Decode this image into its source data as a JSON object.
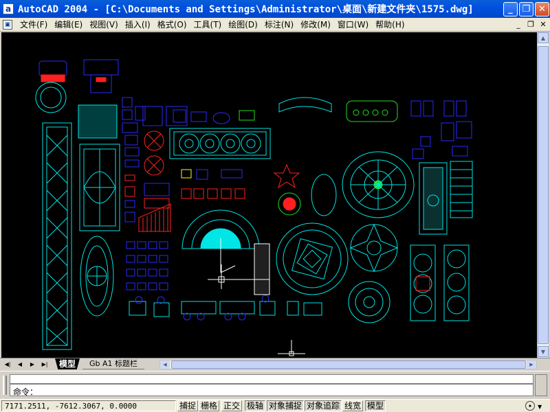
{
  "window": {
    "title": "AutoCAD 2004 - [C:\\Documents and Settings\\Administrator\\桌面\\新建文件夹\\1575.dwg]",
    "app_icon_glyph": "a",
    "min_glyph": "_",
    "max_glyph": "❐",
    "close_glyph": "✕"
  },
  "menu": {
    "items": [
      {
        "label": "文件(F)"
      },
      {
        "label": "编辑(E)"
      },
      {
        "label": "视图(V)"
      },
      {
        "label": "插入(I)"
      },
      {
        "label": "格式(O)"
      },
      {
        "label": "工具(T)"
      },
      {
        "label": "绘图(D)"
      },
      {
        "label": "标注(N)"
      },
      {
        "label": "修改(M)"
      },
      {
        "label": "窗口(W)"
      },
      {
        "label": "帮助(H)"
      }
    ],
    "doc_min": "_",
    "doc_restore": "❐",
    "doc_close": "✕"
  },
  "tabs": {
    "nav_first": "◀|",
    "nav_prev": "◀",
    "nav_next": "▶",
    "nav_last": "▶|",
    "model": "模型",
    "layout": "Gb A1 标题栏"
  },
  "command": {
    "prompt": "命令："
  },
  "status": {
    "coordinates": "7171.2511,   -7612.3067, 0.0000",
    "toggles": [
      {
        "label": "捕捉",
        "pressed": false
      },
      {
        "label": "栅格",
        "pressed": false
      },
      {
        "label": "正交",
        "pressed": false
      },
      {
        "label": "极轴",
        "pressed": true
      },
      {
        "label": "对象捕捉",
        "pressed": true
      },
      {
        "label": "对象追踪",
        "pressed": true
      },
      {
        "label": "线宽",
        "pressed": false
      },
      {
        "label": "模型",
        "pressed": true
      }
    ]
  },
  "colors": {
    "canvas": "#000000",
    "cyan": "#00e5e5",
    "blue": "#2a2aff",
    "red": "#ff2020",
    "green": "#20e020",
    "yellow": "#ffff00",
    "titlebar": "#0050e0"
  }
}
